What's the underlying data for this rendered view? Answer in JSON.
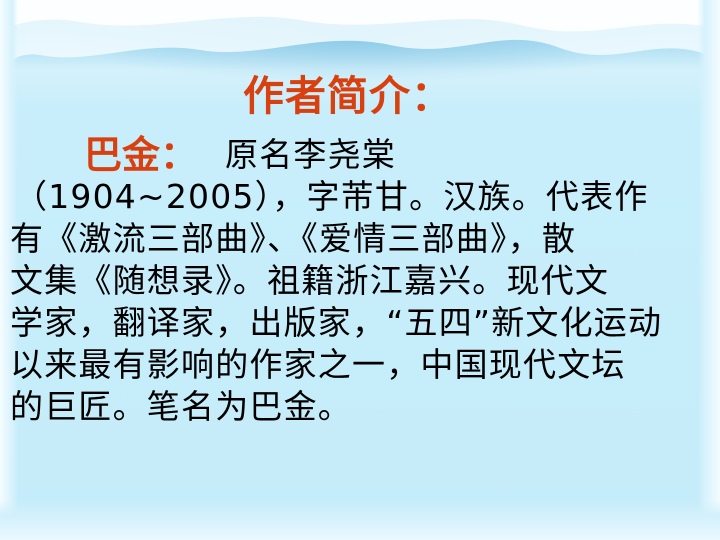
{
  "slide": {
    "title": "作者简介：",
    "name_label": "巴金：",
    "first_line": "原名李尧棠",
    "lines": [
      "（1904~2005），字芾甘。汉族。代表作",
      "有《激流三部曲》、《爱情三部曲》，散",
      "文集《随想录》。祖籍浙江嘉兴。现代文",
      "学家，翻译家，出版家，“五四”新文化运动",
      "以来最有影响的作家之一，中国现代文坛",
      "的巨匠。笔名为巴金。"
    ]
  }
}
